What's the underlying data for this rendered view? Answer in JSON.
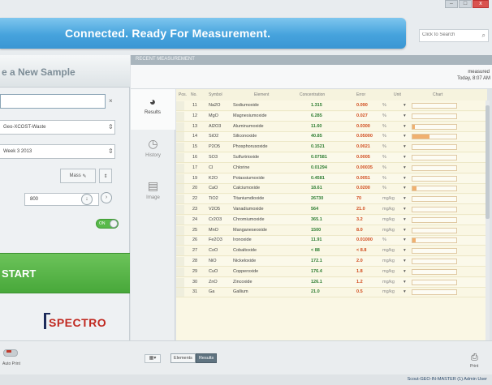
{
  "header": {
    "banner": "Connected. Ready For Measurement.",
    "search_placeholder": "Click to Search",
    "win_minimize": "–",
    "win_maximize": "□",
    "win_close": "x"
  },
  "left": {
    "title": "e a New Sample",
    "sample_name": "",
    "method": "Geo-XCOST-Waste",
    "week": "Week 3 2013",
    "small_btn": "Mass",
    "number_value": "800",
    "toggle_label": "ON",
    "start_label": "START",
    "logo": "SPECTRO"
  },
  "main": {
    "header_title": "RECENT MEASUREMENT",
    "measured_label": "measured",
    "measured_time": "Today, 8:07 AM"
  },
  "tabs": [
    {
      "label": "Results",
      "icon": "pie-chart-icon"
    },
    {
      "label": "History",
      "icon": "clock-icon"
    },
    {
      "label": "Image",
      "icon": "image-icon"
    }
  ],
  "table": {
    "columns": [
      "Pos.",
      "No.",
      "Symbol",
      "Element",
      "Concentration",
      "Error",
      "Unit",
      "Chart"
    ],
    "rows": [
      {
        "no": "11",
        "symbol": "Na2O",
        "element": "Sodiumoxide",
        "conc": "1.315",
        "err": "0.090",
        "unit": "%",
        "fill": 0.0
      },
      {
        "no": "12",
        "symbol": "MgO",
        "element": "Magnesiumoxide",
        "conc": "6.285",
        "err": "0.027",
        "unit": "%",
        "fill": 0.0
      },
      {
        "no": "13",
        "symbol": "Al2O3",
        "element": "Aluminumoxide",
        "conc": "11.60",
        "err": "0.0300",
        "unit": "%",
        "fill": 0.06
      },
      {
        "no": "14",
        "symbol": "SiO2",
        "element": "Siliconoxide",
        "conc": "40.85",
        "err": "0.05000",
        "unit": "%",
        "fill": 0.38
      },
      {
        "no": "15",
        "symbol": "P2O5",
        "element": "Phosphorusoxide",
        "conc": "0.1521",
        "err": "0.0021",
        "unit": "%",
        "fill": 0.0
      },
      {
        "no": "16",
        "symbol": "SO3",
        "element": "Sulfurtrioxide",
        "conc": "0.07581",
        "err": "0.0005",
        "unit": "%",
        "fill": 0.0
      },
      {
        "no": "17",
        "symbol": "Cl",
        "element": "Chlorine",
        "conc": "0.01294",
        "err": "0.00035",
        "unit": "%",
        "fill": 0.0
      },
      {
        "no": "19",
        "symbol": "K2O",
        "element": "Potassiumoxide",
        "conc": "0.4581",
        "err": "0.0051",
        "unit": "%",
        "fill": 0.0
      },
      {
        "no": "20",
        "symbol": "CaO",
        "element": "Calciumoxide",
        "conc": "18.61",
        "err": "0.0200",
        "unit": "%",
        "fill": 0.1
      },
      {
        "no": "22",
        "symbol": "TiO2",
        "element": "Titaniumdioxide",
        "conc": "26730",
        "err": "70",
        "unit": "mg/kg",
        "fill": 0.0
      },
      {
        "no": "23",
        "symbol": "V2O5",
        "element": "Vanadiumoxide",
        "conc": "564",
        "err": "21.0",
        "unit": "mg/kg",
        "fill": 0.0
      },
      {
        "no": "24",
        "symbol": "Cr2O3",
        "element": "Chromiumoxide",
        "conc": "365.1",
        "err": "3.2",
        "unit": "mg/kg",
        "fill": 0.0
      },
      {
        "no": "25",
        "symbol": "MnO",
        "element": "Manganeseoxide",
        "conc": "1500",
        "err": "8.0",
        "unit": "mg/kg",
        "fill": 0.0
      },
      {
        "no": "26",
        "symbol": "Fe2O3",
        "element": "Ironoxide",
        "conc": "11.91",
        "err": "0.01000",
        "unit": "%",
        "fill": 0.07
      },
      {
        "no": "27",
        "symbol": "CoO",
        "element": "Cobaltoxide",
        "conc": "< 88",
        "err": "< 8.8",
        "unit": "mg/kg",
        "fill": 0.0
      },
      {
        "no": "28",
        "symbol": "NiO",
        "element": "Nickeloxide",
        "conc": "172.1",
        "err": "2.0",
        "unit": "mg/kg",
        "fill": 0.0
      },
      {
        "no": "29",
        "symbol": "CuO",
        "element": "Copperoxide",
        "conc": "176.4",
        "err": "1.8",
        "unit": "mg/kg",
        "fill": 0.0
      },
      {
        "no": "30",
        "symbol": "ZnO",
        "element": "Zincoxide",
        "conc": "126.1",
        "err": "1.2",
        "unit": "mg/kg",
        "fill": 0.0
      },
      {
        "no": "31",
        "symbol": "Ga",
        "element": "Gallium",
        "conc": "21.0",
        "err": "0.5",
        "unit": "mg/kg",
        "fill": 0.0
      }
    ]
  },
  "bottom": {
    "autoprint_label": "Auto Print",
    "grid_btn": "▦▾",
    "seg_left": "Elements",
    "seg_right": "Results",
    "print_label": "Print",
    "status_text": "Scout-GEO-IN-MASTER (1)   Admin User"
  },
  "colors": {
    "accent": "#46a3dd",
    "start": "#48a83a",
    "concentration": "#2e7d32",
    "error": "#d04a1c",
    "logo": "#c0281f"
  }
}
